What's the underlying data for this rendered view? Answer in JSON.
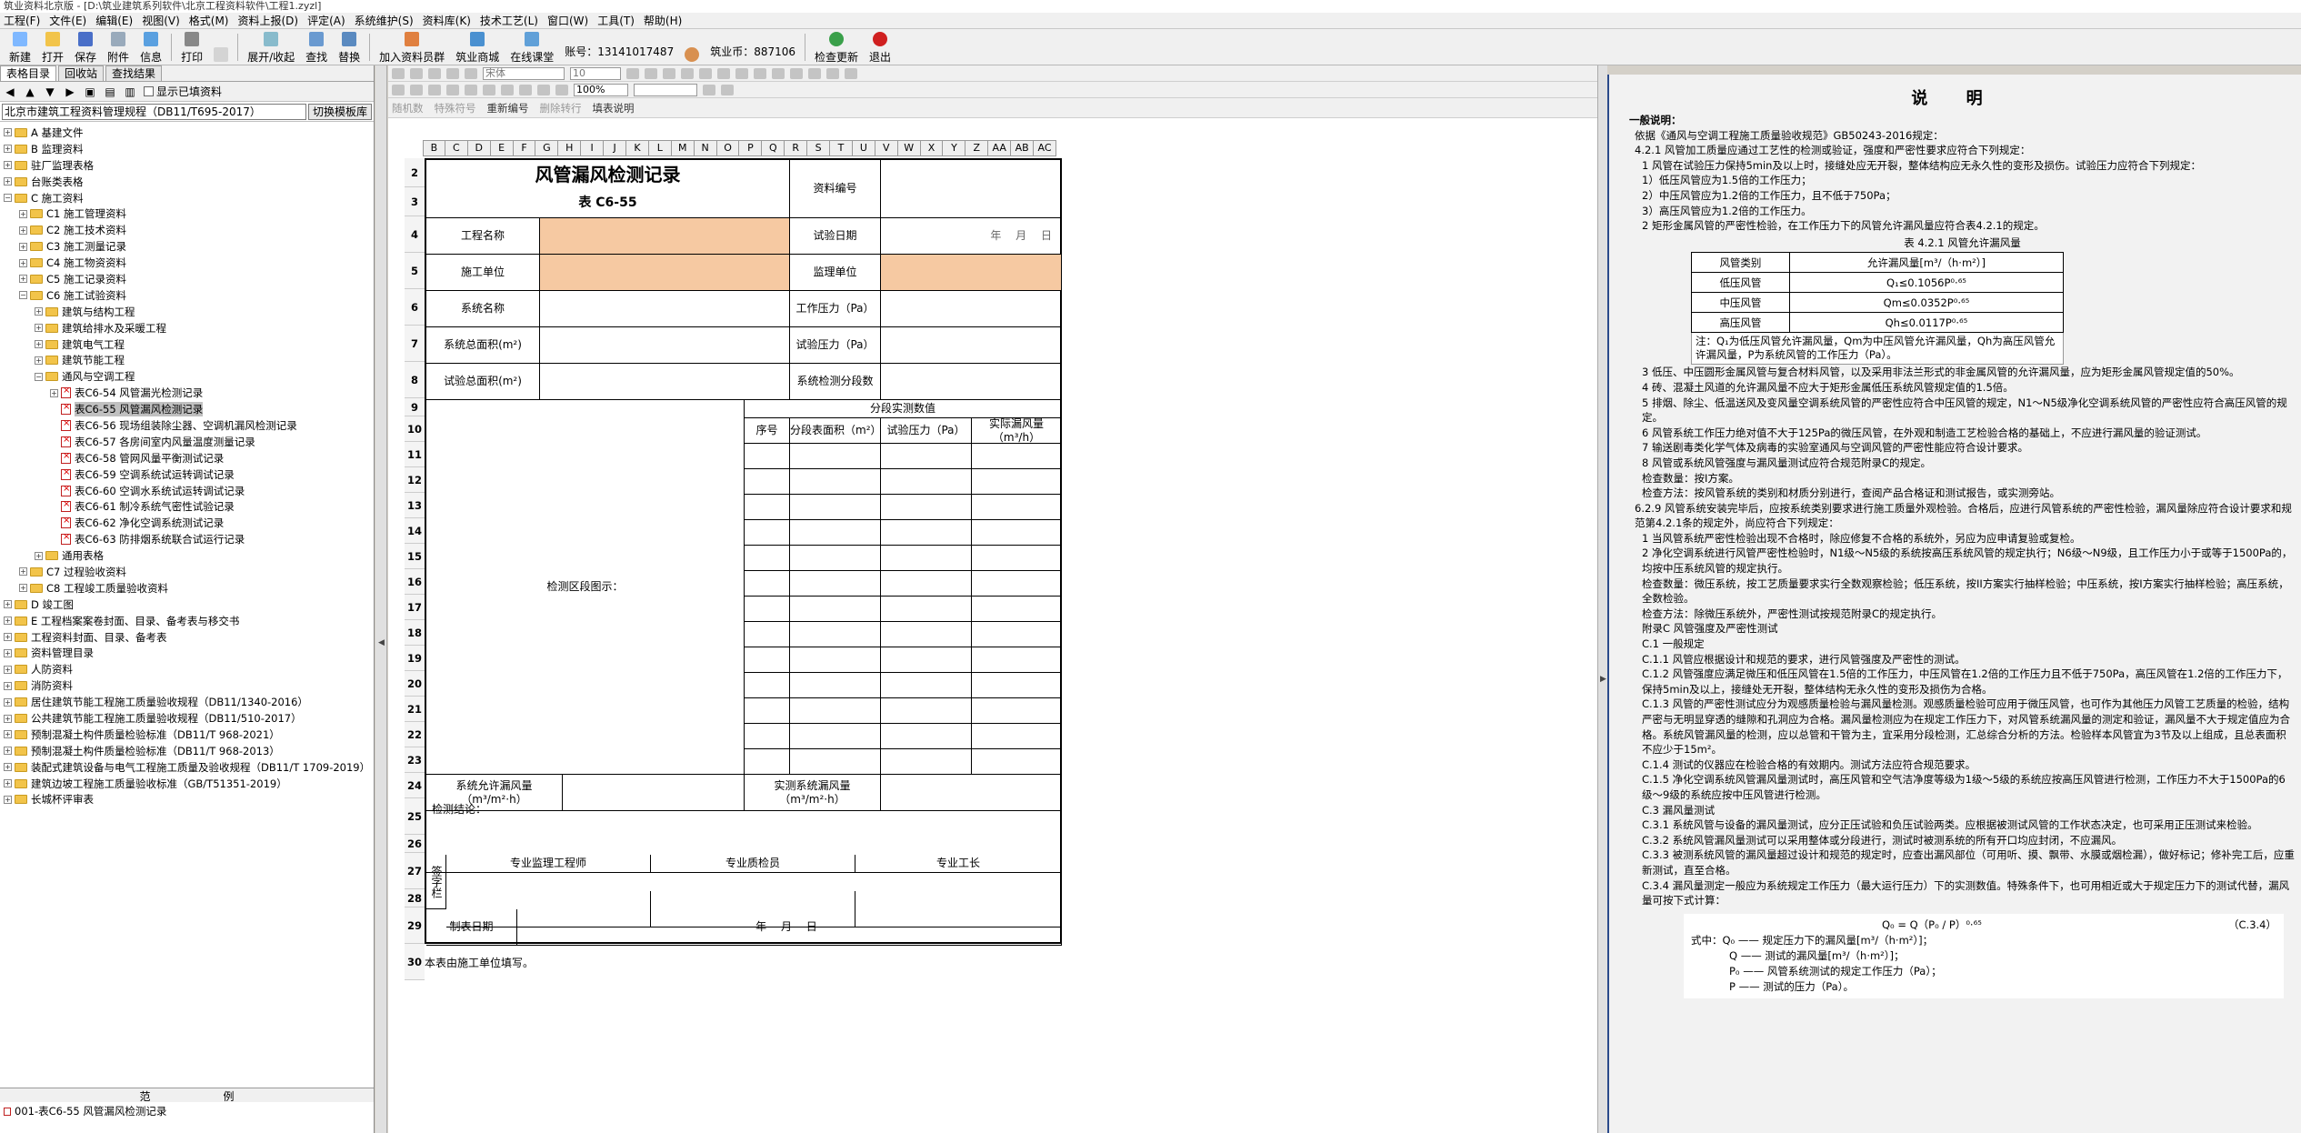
{
  "window": {
    "title": "筑业资料北京版 - [D:\\筑业建筑系列软件\\北京工程资料软件\\工程1.zyzl]"
  },
  "menu": [
    "工程(F)",
    "文件(E)",
    "编辑(E)",
    "视图(V)",
    "格式(M)",
    "资料上报(D)",
    "评定(A)",
    "系统维护(S)",
    "资料库(K)",
    "技术工艺(L)",
    "窗口(W)",
    "工具(T)",
    "帮助(H)"
  ],
  "toolbar": {
    "buttons": [
      "新建",
      "打开",
      "保存",
      "附件",
      "信息",
      "打印",
      "展开/收起",
      "查找",
      "替换",
      "加入资料员群",
      "筑业商城",
      "在线课堂"
    ],
    "account": "账号：13141017487",
    "coins": "筑业币：887106",
    "update": "检查更新",
    "exit": "退出"
  },
  "left_panel": {
    "tabs": [
      "表格目录",
      "回收站",
      "查找结果"
    ],
    "show_filled": "显示已填资料",
    "norm": "北京市建筑工程资料管理规程（DB11/T695-2017）",
    "switch_btn": "切换模板库",
    "tree": [
      {
        "indent": 0,
        "type": "folder",
        "exp": "+",
        "label": "A 基建文件"
      },
      {
        "indent": 0,
        "type": "folder",
        "exp": "+",
        "label": "B 监理资料"
      },
      {
        "indent": 0,
        "type": "folder",
        "exp": "+",
        "label": "驻厂监理表格"
      },
      {
        "indent": 0,
        "type": "folder",
        "exp": "+",
        "label": "台账类表格"
      },
      {
        "indent": 0,
        "type": "folder",
        "exp": "-",
        "label": "C 施工资料"
      },
      {
        "indent": 1,
        "type": "folder",
        "exp": "+",
        "label": "C1 施工管理资料"
      },
      {
        "indent": 1,
        "type": "folder",
        "exp": "+",
        "label": "C2 施工技术资料"
      },
      {
        "indent": 1,
        "type": "folder",
        "exp": "+",
        "label": "C3 施工测量记录"
      },
      {
        "indent": 1,
        "type": "folder",
        "exp": "+",
        "label": "C4 施工物资资料"
      },
      {
        "indent": 1,
        "type": "folder",
        "exp": "+",
        "label": "C5 施工记录资料"
      },
      {
        "indent": 1,
        "type": "folder",
        "exp": "-",
        "label": "C6 施工试验资料"
      },
      {
        "indent": 2,
        "type": "folder",
        "exp": "+",
        "label": "建筑与结构工程"
      },
      {
        "indent": 2,
        "type": "folder",
        "exp": "+",
        "label": "建筑给排水及采暖工程"
      },
      {
        "indent": 2,
        "type": "folder",
        "exp": "+",
        "label": "建筑电气工程"
      },
      {
        "indent": 2,
        "type": "folder",
        "exp": "+",
        "label": "建筑节能工程"
      },
      {
        "indent": 2,
        "type": "folder",
        "exp": "-",
        "label": "通风与空调工程"
      },
      {
        "indent": 3,
        "type": "doc",
        "exp": "+",
        "label": "表C6-54 风管漏光检测记录"
      },
      {
        "indent": 3,
        "type": "doc",
        "exp": "",
        "label": "表C6-55 风管漏风检测记录",
        "selected": true
      },
      {
        "indent": 3,
        "type": "doc",
        "exp": "",
        "label": "表C6-56 现场组装除尘器、空调机漏风检测记录"
      },
      {
        "indent": 3,
        "type": "doc",
        "exp": "",
        "label": "表C6-57 各房间室内风量温度测量记录"
      },
      {
        "indent": 3,
        "type": "doc",
        "exp": "",
        "label": "表C6-58 管网风量平衡测试记录"
      },
      {
        "indent": 3,
        "type": "doc",
        "exp": "",
        "label": "表C6-59 空调系统试运转调试记录"
      },
      {
        "indent": 3,
        "type": "doc",
        "exp": "",
        "label": "表C6-60 空调水系统试运转调试记录"
      },
      {
        "indent": 3,
        "type": "doc",
        "exp": "",
        "label": "表C6-61 制冷系统气密性试验记录"
      },
      {
        "indent": 3,
        "type": "doc",
        "exp": "",
        "label": "表C6-62 净化空调系统测试记录"
      },
      {
        "indent": 3,
        "type": "doc",
        "exp": "",
        "label": "表C6-63 防排烟系统联合试运行记录"
      },
      {
        "indent": 2,
        "type": "folder",
        "exp": "+",
        "label": "通用表格"
      },
      {
        "indent": 1,
        "type": "folder",
        "exp": "+",
        "label": "C7 过程验收资料"
      },
      {
        "indent": 1,
        "type": "folder",
        "exp": "+",
        "label": "C8 工程竣工质量验收资料"
      },
      {
        "indent": 0,
        "type": "folder",
        "exp": "+",
        "label": "D 竣工图"
      },
      {
        "indent": 0,
        "type": "folder",
        "exp": "+",
        "label": "E 工程档案案卷封面、目录、备考表与移交书"
      },
      {
        "indent": 0,
        "type": "folder",
        "exp": "+",
        "label": "工程资料封面、目录、备考表"
      },
      {
        "indent": 0,
        "type": "folder",
        "exp": "+",
        "label": "资料管理目录"
      },
      {
        "indent": 0,
        "type": "folder",
        "exp": "+",
        "label": "人防资料"
      },
      {
        "indent": 0,
        "type": "folder",
        "exp": "+",
        "label": "消防资料"
      },
      {
        "indent": 0,
        "type": "folder",
        "exp": "+",
        "label": "居住建筑节能工程施工质量验收规程（DB11/1340-2016）"
      },
      {
        "indent": 0,
        "type": "folder",
        "exp": "+",
        "label": "公共建筑节能工程施工质量验收规程（DB11/510-2017）"
      },
      {
        "indent": 0,
        "type": "folder",
        "exp": "+",
        "label": "预制混凝土构件质量检验标准（DB11/T 968-2021）"
      },
      {
        "indent": 0,
        "type": "folder",
        "exp": "+",
        "label": "预制混凝土构件质量检验标准（DB11/T 968-2013）"
      },
      {
        "indent": 0,
        "type": "folder",
        "exp": "+",
        "label": "装配式建筑设备与电气工程施工质量及验收规程（DB11/T 1709-2019）"
      },
      {
        "indent": 0,
        "type": "folder",
        "exp": "+",
        "label": "建筑边坡工程施工质量验收标准（GB/T51351-2019）"
      },
      {
        "indent": 0,
        "type": "folder",
        "exp": "+",
        "label": "长城杯评审表"
      }
    ],
    "bottom_tabs": [
      "范",
      "例"
    ],
    "bottom_list": "001-表C6-55 风管漏风检测记录"
  },
  "editor": {
    "row3_labels": [
      "随机数",
      "特殊符号",
      "重新编号",
      "删除转行",
      "填表说明"
    ],
    "font": "宋体",
    "size": "10",
    "zoom": "100%",
    "columns": [
      "B",
      "C",
      "D",
      "E",
      "F",
      "G",
      "H",
      "I",
      "J",
      "K",
      "L",
      "M",
      "N",
      "O",
      "P",
      "Q",
      "R",
      "S",
      "T",
      "U",
      "V",
      "W",
      "X",
      "Y",
      "Z",
      "AA",
      "AB",
      "AC"
    ],
    "form": {
      "title": "风管漏风检测记录",
      "subtitle": "表 C6-55",
      "doc_no": "资料编号",
      "project_name": "工程名称",
      "test_date": "试验日期",
      "date_placeholder": "年 月 日",
      "builder": "施工单位",
      "supervisor": "监理单位",
      "system_name": "系统名称",
      "working_pressure": "工作压力（Pa）",
      "total_area": "系统总面积(m²)",
      "test_pressure": "试验压力（Pa）",
      "test_total_area": "试验总面积(m²)",
      "segments": "系统检测分段数",
      "segment_values": "分段实测数值",
      "seq": "序号",
      "seg_area": "分段表面积（m²）",
      "seg_pressure": "试验压力（Pa）",
      "seg_leak": "实际漏风量（m³/h）",
      "diagram": "检测区段图示：",
      "allowed_leak": "系统允许漏风量（m³/m²·h）",
      "measured_leak": "实测系统漏风量（m³/m²·h）",
      "conclusion": "检测结论：",
      "sign_col": "签字栏",
      "sup_eng": "专业监理工程师",
      "qc": "专业质检员",
      "foreman": "专业工长",
      "fill_date": "制表日期",
      "note": "本表由施工单位填写。"
    },
    "row_numbers": [
      "2",
      "3",
      "4",
      "5",
      "6",
      "7",
      "8",
      "9",
      "10",
      "11",
      "12",
      "13",
      "14",
      "15",
      "16",
      "17",
      "18",
      "19",
      "20",
      "21",
      "22",
      "23",
      "24",
      "25",
      "26",
      "27",
      "28",
      "29",
      "30"
    ]
  },
  "explain": {
    "title": "说 明",
    "general": "一般说明：",
    "paras": [
      "依据《通风与空调工程施工质量验收规范》GB50243-2016规定：",
      "4.2.1  风管加工质量应通过工艺性的检测或验证，强度和严密性要求应符合下列规定：",
      "1  风管在试验压力保持5min及以上时，接缝处应无开裂，整体结构应无永久性的变形及损伤。试验压力应符合下列规定：",
      "1）低压风管应为1.5倍的工作压力；",
      "2）中压风管应为1.2倍的工作压力，且不低于750Pa；",
      "3）高压风管应为1.2倍的工作压力。",
      "2  矩形金属风管的严密性检验，在工作压力下的风管允许漏风量应符合表4.2.1的规定。"
    ],
    "table_caption": "表 4.2.1  风管允许漏风量",
    "table_head": [
      "风管类别",
      "允许漏风量[m³/（h·m²）]"
    ],
    "table_rows": [
      [
        "低压风管",
        "Q₁≤0.1056P⁰·⁶⁵"
      ],
      [
        "中压风管",
        "Qm≤0.0352P⁰·⁶⁵"
      ],
      [
        "高压风管",
        "Qh≤0.0117P⁰·⁶⁵"
      ]
    ],
    "table_note": "注：Q₁为低压风管允许漏风量，Qm为中压风管允许漏风量，Qh为高压风管允许漏风量，P为系统风管的工作压力（Pa）。",
    "paras2": [
      "3  低压、中压圆形金属风管与复合材料风管，以及采用非法兰形式的非金属风管的允许漏风量，应为矩形金属风管规定值的50%。",
      "4  砖、混凝土风道的允许漏风量不应大于矩形金属低压系统风管规定值的1.5倍。",
      "5  排烟、除尘、低温送风及变风量空调系统风管的严密性应符合中压风管的规定，N1～N5级净化空调系统风管的严密性应符合高压风管的规定。",
      "6  风管系统工作压力绝对值不大于125Pa的微压风管，在外观和制造工艺检验合格的基础上，不应进行漏风量的验证测试。",
      "7  输送剧毒类化学气体及病毒的实验室通风与空调风管的严密性能应符合设计要求。",
      "8  风管或系统风管强度与漏风量测试应符合规范附录C的规定。",
      "检查数量：按I方案。",
      "检查方法：按风管系统的类别和材质分别进行，查阅产品合格证和测试报告，或实测旁站。",
      "6.2.9  风管系统安装完毕后，应按系统类别要求进行施工质量外观检验。合格后，应进行风管系统的严密性检验，漏风量除应符合设计要求和规范第4.2.1条的规定外，尚应符合下列规定：",
      "1  当风管系统严密性检验出现不合格时，除应修复不合格的系统外，另应为应申请复验或复检。",
      "2  净化空调系统进行风管严密性检验时，N1级～N5级的系统按高压系统风管的规定执行；N6级～N9级，且工作压力小于或等于1500Pa的，均按中压系统风管的规定执行。",
      "检查数量：微压系统，按工艺质量要求实行全数观察检验；低压系统，按II方案实行抽样检验；中压系统，按I方案实行抽样检验；高压系统，全数检验。",
      "检查方法：除微压系统外，严密性测试按规范附录C的规定执行。",
      "附录C  风管强度及严密性测试",
      "C.1  一般规定",
      "C.1.1  风管应根据设计和规范的要求，进行风管强度及严密性的测试。",
      "C.1.2  风管强度应满足微压和低压风管在1.5倍的工作压力，中压风管在1.2倍的工作压力且不低于750Pa，高压风管在1.2倍的工作压力下，保持5min及以上，接缝处无开裂，整体结构无永久性的变形及损伤为合格。",
      "C.1.3  风管的严密性测试应分为观感质量检验与漏风量检测。观感质量检验可应用于微压风管，也可作为其他压力风管工艺质量的检验，结构严密与无明显穿透的缝隙和孔洞应为合格。漏风量检测应为在规定工作压力下，对风管系统漏风量的测定和验证，漏风量不大于规定值应为合格。系统风管漏风量的检测，应以总管和干管为主，宜采用分段检测，汇总综合分析的方法。检验样本风管宜为3节及以上组成，且总表面积不应少于15m²。",
      "C.1.4  测试的仪器应在检验合格的有效期内。测试方法应符合规范要求。",
      "C.1.5  净化空调系统风管漏风量测试时，高压风管和空气洁净度等级为1级～5级的系统应按高压风管进行检测，工作压力不大于1500Pa的6级～9级的系统应按中压风管进行检测。",
      "C.3  漏风量测试",
      "C.3.1  系统风管与设备的漏风量测试，应分正压试验和负压试验两类。应根据被测试风管的工作状态决定，也可采用正压测试来检验。",
      "C.3.2  系统风管漏风量测试可以采用整体或分段进行，测试时被测系统的所有开口均应封闭，不应漏风。",
      "C.3.3  被测系统风管的漏风量超过设计和规范的规定时，应查出漏风部位（可用听、摸、飘带、水膜或烟检漏），做好标记；修补完工后，应重新测试，直至合格。",
      "C.3.4  漏风量测定一般应为系统规定工作压力（最大运行压力）下的实测数值。特殊条件下，也可用相近或大于规定压力下的测试代替，漏风量可按下式计算："
    ],
    "formula": "Q₀ = Q（P₀ / P）⁰·⁶⁵",
    "formula_no": "（C.3.4）",
    "formula_defs": [
      "式中：Q₀ —— 规定压力下的漏风量[m³/（h·m²）]；",
      "Q —— 测试的漏风量[m³/（h·m²）]；",
      "P₀ —— 风管系统测试的规定工作压力（Pa）；",
      "P —— 测试的压力（Pa）。"
    ]
  }
}
